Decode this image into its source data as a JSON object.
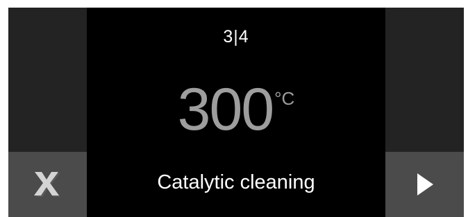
{
  "step_indicator": "3|4",
  "temperature": {
    "value": "300",
    "unit": "°C"
  },
  "program_name": "Catalytic cleaning",
  "buttons": {
    "cancel_icon": "close-icon",
    "next_icon": "play-arrow-icon"
  },
  "colors": {
    "screen_bg": "#000000",
    "side_panel": "#232323",
    "button_bg": "#4b4b4b",
    "primary_text": "#ffffff",
    "temperature_text": "#9e9e9e"
  }
}
